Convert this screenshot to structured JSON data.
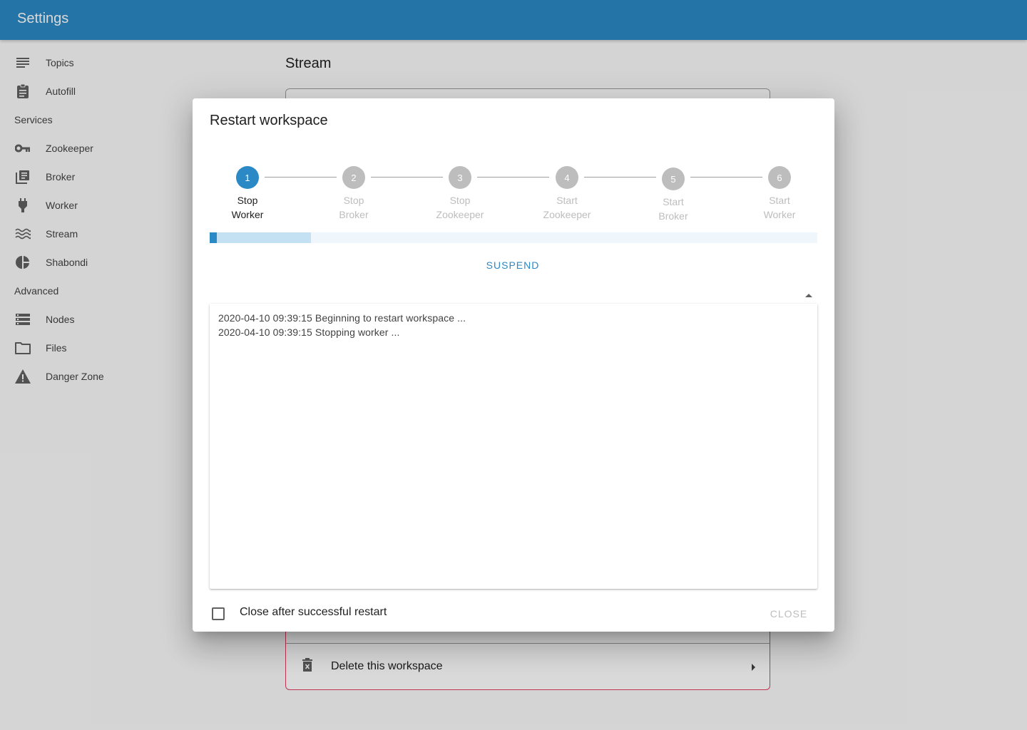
{
  "appbar": {
    "title": "Settings"
  },
  "sidebar": {
    "items": [
      {
        "label": "Topics",
        "icon": "topics-icon"
      },
      {
        "label": "Autofill",
        "icon": "clipboard-icon"
      }
    ],
    "services_header": "Services",
    "services": [
      {
        "label": "Zookeeper",
        "icon": "key-icon"
      },
      {
        "label": "Broker",
        "icon": "library-books-icon"
      },
      {
        "label": "Worker",
        "icon": "power-plug-icon"
      },
      {
        "label": "Stream",
        "icon": "waves-icon"
      },
      {
        "label": "Shabondi",
        "icon": "pie-chart-icon"
      }
    ],
    "advanced_header": "Advanced",
    "advanced": [
      {
        "label": "Nodes",
        "icon": "storage-icon"
      },
      {
        "label": "Files",
        "icon": "folder-icon"
      },
      {
        "label": "Danger Zone",
        "icon": "warning-icon"
      }
    ]
  },
  "main": {
    "title": "Stream",
    "danger": {
      "delete_label": "Delete this workspace"
    }
  },
  "dialog": {
    "title": "Restart workspace",
    "steps": [
      {
        "number": "1",
        "label_line1": "Stop",
        "label_line2": "Worker",
        "active": true
      },
      {
        "number": "2",
        "label_line1": "Stop",
        "label_line2": "Broker",
        "active": false
      },
      {
        "number": "3",
        "label_line1": "Stop",
        "label_line2": "Zookeeper",
        "active": false
      },
      {
        "number": "4",
        "label_line1": "Start",
        "label_line2": "Zookeeper",
        "active": false
      },
      {
        "number": "5",
        "label_line1": "Start",
        "label_line2": "Broker",
        "active": false
      },
      {
        "number": "6",
        "label_line1": "Start",
        "label_line2": "Worker",
        "active": false
      }
    ],
    "progress": {
      "value": 0.012,
      "buffer": 0.167
    },
    "suspend_label": "SUSPEND",
    "log_lines": [
      "2020-04-10 09:39:15 Beginning to restart workspace ...",
      "2020-04-10 09:39:15 Stopping worker ..."
    ],
    "close_after_label": "Close after successful restart",
    "close_after_checked": false,
    "close_label": "CLOSE"
  },
  "colors": {
    "primary": "#2b89c6",
    "danger": "#e53e63",
    "disabled": "#bdbdbd"
  }
}
